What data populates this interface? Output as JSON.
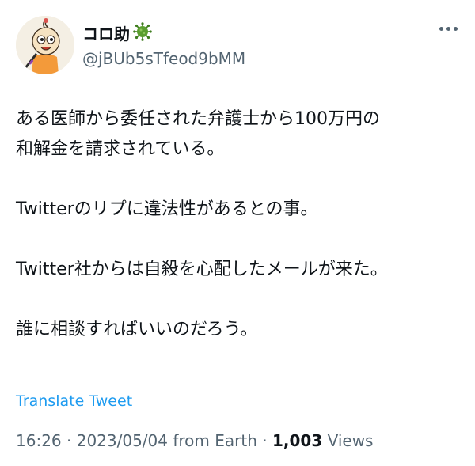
{
  "author": {
    "display_name": "コロ助",
    "badge_icon": "virus-icon",
    "handle": "@jBUb5sTfeod9bMM"
  },
  "tweet": {
    "lines": [
      "ある医師から委任された弁護士から100万円の",
      "和解金を請求されている。",
      "Twitterのリプに違法性があるとの事。",
      "Twitter社からは自殺を心配したメールが来た。",
      "誰に相談すればいいのだろう。"
    ]
  },
  "translate_label": "Translate Tweet",
  "meta": {
    "time": "16:26",
    "sep1": " · ",
    "date": "2023/05/04",
    "source": " from Earth",
    "sep2": " · ",
    "views_count": "1,003",
    "views_label": " Views"
  },
  "colors": {
    "link": "#1d9bf0",
    "secondary_text": "#536471",
    "primary_text": "#0f1419",
    "badge_green": "#5a9e2f"
  }
}
